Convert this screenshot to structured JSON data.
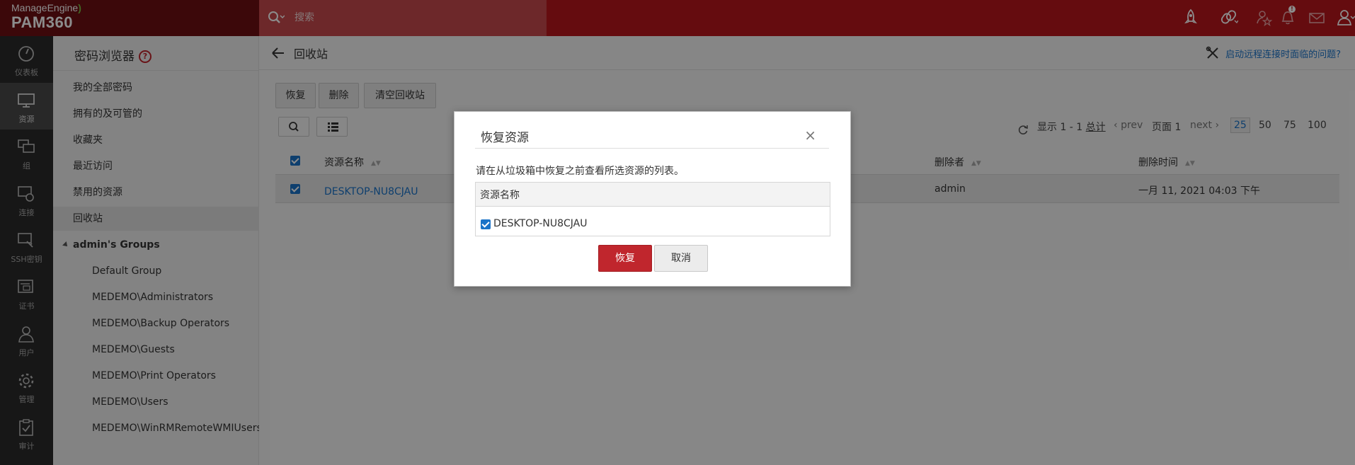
{
  "brand": {
    "company": "ManageEngine",
    "product": "PAM360"
  },
  "search": {
    "placeholder": "搜索"
  },
  "topbar_icons": [
    "rocket-icon",
    "link-icon",
    "star-person-icon",
    "bell-icon",
    "mail-icon",
    "user-menu-icon"
  ],
  "notification_badge": "!",
  "leftnav": [
    {
      "label": "仪表板",
      "icon": "dashboard-icon"
    },
    {
      "label": "资源",
      "icon": "monitor-icon",
      "active": true
    },
    {
      "label": "组",
      "icon": "group-icon"
    },
    {
      "label": "连接",
      "icon": "connection-icon"
    },
    {
      "label": "SSH密钥",
      "icon": "ssh-key-icon"
    },
    {
      "label": "证书",
      "icon": "certificate-icon"
    },
    {
      "label": "用户",
      "icon": "user-icon"
    },
    {
      "label": "管理",
      "icon": "gear-icon"
    },
    {
      "label": "审计",
      "icon": "audit-icon"
    }
  ],
  "sidebar": {
    "title": "密码浏览器",
    "help": "?",
    "items": [
      "我的全部密码",
      "拥有的及可管的",
      "收藏夹",
      "最近访问",
      "禁用的资源",
      "回收站"
    ],
    "group_title": "admin's Groups",
    "groups": [
      "Default Group",
      "MEDEMO\\Administrators",
      "MEDEMO\\Backup Operators",
      "MEDEMO\\Guests",
      "MEDEMO\\Print Operators",
      "MEDEMO\\Users",
      "MEDEMO\\WinRMRemoteWMIUsers"
    ]
  },
  "main": {
    "title": "回收站",
    "remote_help": "启动远程连接时面临的问题?",
    "actions": {
      "restore": "恢复",
      "delete": "删除",
      "empty": "清空回收站"
    },
    "pager": {
      "showing": "显示 1 - 1",
      "total": "总计",
      "prev": "prev",
      "page": "页面 1",
      "next": "next",
      "sizes": [
        "25",
        "50",
        "75",
        "100"
      ],
      "selected_size": "25"
    },
    "table": {
      "columns": {
        "name": "资源名称",
        "deleted_by": "删除者",
        "deleted_time": "删除时间"
      },
      "rows": [
        {
          "name": "DESKTOP-NU8CJAU",
          "deleted_by": "admin",
          "deleted_time": "一月 11, 2021 04:03 下午"
        }
      ]
    }
  },
  "dialog": {
    "title": "恢复资源",
    "close": "×",
    "message": "请在从垃圾箱中恢复之前查看所选资源的列表。",
    "column": "资源名称",
    "resource": "DESKTOP-NU8CJAU",
    "confirm": "恢复",
    "cancel": "取消"
  },
  "colors": {
    "brand_red": "#b8161c",
    "dark_red": "#6d0f13",
    "nav_dark": "#2b2b2b",
    "link_blue": "#1a73c8",
    "primary_button": "#c0262d"
  }
}
